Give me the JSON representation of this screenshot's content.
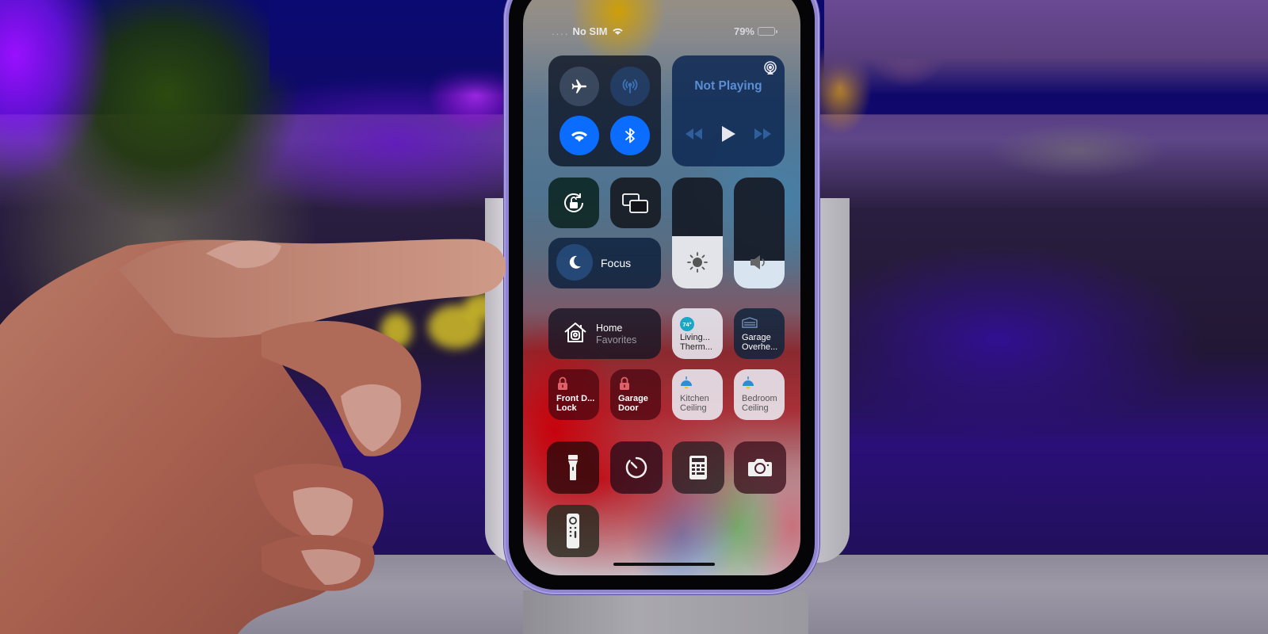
{
  "status_bar": {
    "signal_dots": "....",
    "carrier": "No SIM",
    "battery_percent_label": "79%",
    "battery_level": 0.79
  },
  "connectivity": {
    "airplane_mode": {
      "label": "Airplane Mode",
      "state": "off",
      "icon": "airplane-icon"
    },
    "cellular_data": {
      "label": "Cellular Data",
      "state": "disabled",
      "icon": "antenna-icon"
    },
    "wifi": {
      "label": "Wi-Fi",
      "state": "on",
      "icon": "wifi-icon"
    },
    "bluetooth": {
      "label": "Bluetooth",
      "state": "on",
      "icon": "bluetooth-icon"
    }
  },
  "now_playing": {
    "title": "Not Playing",
    "controls": [
      "rewind",
      "play",
      "fast-forward"
    ],
    "airplay_icon": "airplay-audio-icon"
  },
  "toggles": {
    "orientation_lock": {
      "icon": "rotation-lock-icon"
    },
    "screen_mirroring": {
      "icon": "screen-mirroring-icon"
    }
  },
  "focus": {
    "label": "Focus",
    "icon": "moon-icon"
  },
  "sliders": {
    "brightness": {
      "level": 0.47,
      "icon": "sun-icon"
    },
    "volume": {
      "level": 0.25,
      "icon": "speaker-icon"
    }
  },
  "home": {
    "title": "Home",
    "subtitle": "Favorites",
    "accessories": [
      {
        "name_line1": "Living...",
        "name_line2": "Therm...",
        "badge": "74°",
        "style": "light"
      },
      {
        "name_line1": "Garage",
        "name_line2": "Overhe...",
        "style": "dark"
      },
      {
        "name_line1": "Front D...",
        "name_line2": "Lock",
        "style": "red"
      },
      {
        "name_line1": "Garage",
        "name_line2": "Door",
        "style": "red"
      },
      {
        "name_line1": "Kitchen",
        "name_line2": "Ceiling",
        "style": "light"
      },
      {
        "name_line1": "Bedroom",
        "name_line2": "Ceiling",
        "style": "light"
      }
    ]
  },
  "shortcuts": [
    {
      "name": "Flashlight",
      "icon": "flashlight-icon"
    },
    {
      "name": "Timer",
      "icon": "timer-icon"
    },
    {
      "name": "Calculator",
      "icon": "calculator-icon"
    },
    {
      "name": "Camera",
      "icon": "camera-icon"
    },
    {
      "name": "Apple TV Remote",
      "icon": "remote-icon"
    }
  ],
  "colors": {
    "accent_blue": "#0a6dff",
    "now_playing_text": "#5a8ed6",
    "lock_red": "#e0606a",
    "thermostat_teal": "#1aa6c4",
    "light_blue": "#2b8fd6"
  }
}
